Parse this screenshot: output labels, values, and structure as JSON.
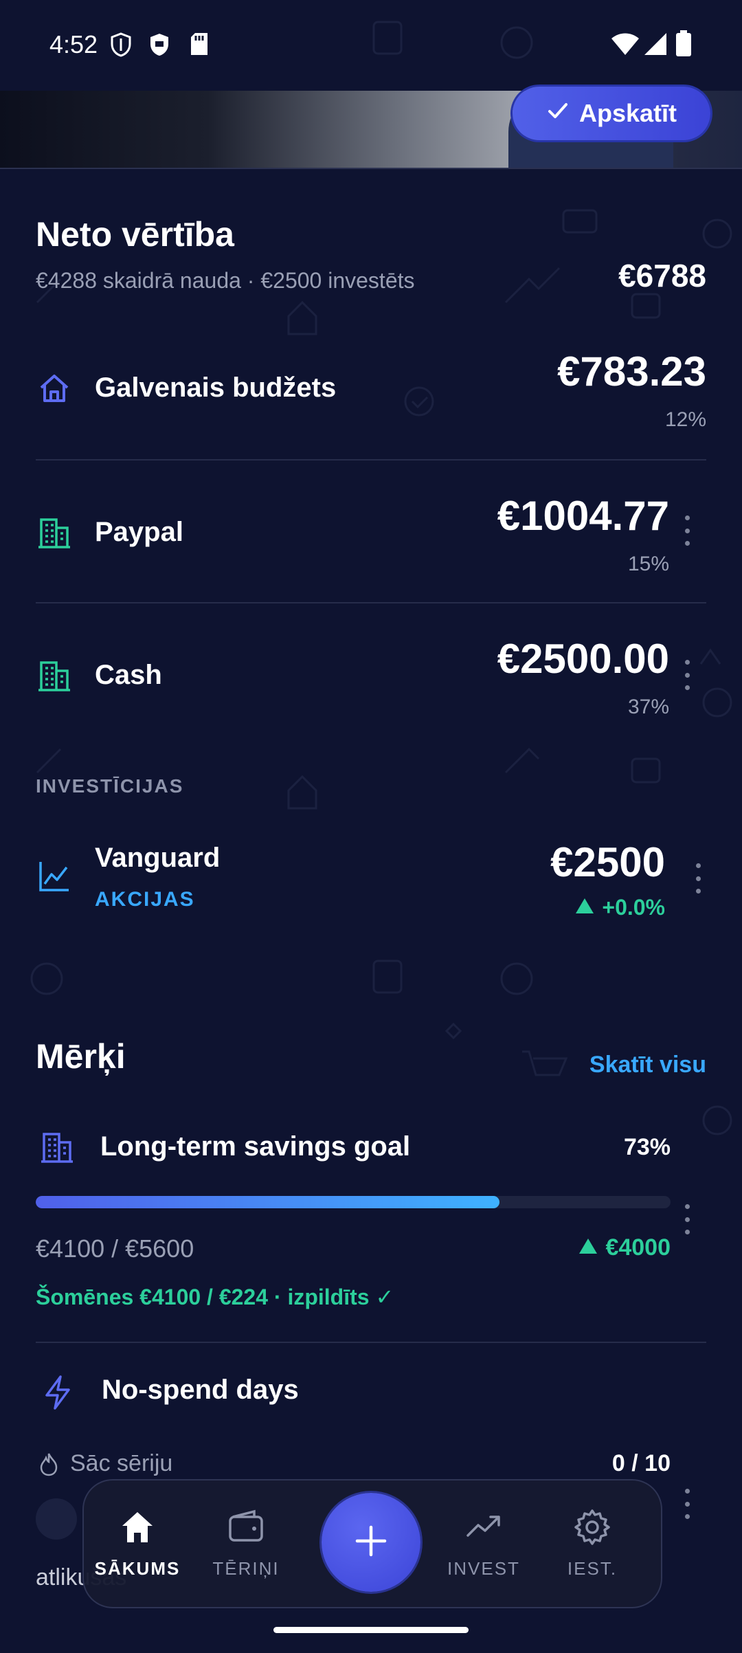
{
  "status_bar": {
    "time": "4:52"
  },
  "banner": {
    "view_button_label": "Apskatīt"
  },
  "net_worth": {
    "title": "Neto vērtība",
    "subtitle": "€4288 skaidrā nauda · €2500 investēts",
    "total": "€6788"
  },
  "accounts": [
    {
      "name": "Galvenais budžets",
      "amount": "€783.23",
      "percent": "12%",
      "icon": "home-icon"
    },
    {
      "name": "Paypal",
      "amount": "€1004.77",
      "percent": "15%",
      "icon": "building-icon"
    },
    {
      "name": "Cash",
      "amount": "€2500.00",
      "percent": "37%",
      "icon": "building-icon"
    }
  ],
  "investments": {
    "section_label": "INVESTĪCIJAS",
    "items": [
      {
        "name": "Vanguard",
        "type": "AKCIJAS",
        "amount": "€2500",
        "change": "+0.0%",
        "icon": "chart-line-icon"
      }
    ]
  },
  "goals": {
    "title": "Mērķi",
    "see_all": "Skatīt visu",
    "items": [
      {
        "name": "Long-term savings goal",
        "percent": "73%",
        "progress": 0.73,
        "progress_text": "€4100 / €5600",
        "gain": "€4000",
        "note": "Šomēnes €4100 / €224 · izpildīts ✓"
      }
    ]
  },
  "no_spend": {
    "title": "No-spend days",
    "streak_label": "Sāc sēriju",
    "streak_count": "0 / 10",
    "remaining_label": "atlikušas"
  },
  "bottom_nav": {
    "items": [
      {
        "label": "SĀKUMS",
        "icon": "home-icon",
        "active": true
      },
      {
        "label": "TĒRIŅI",
        "icon": "wallet-icon",
        "active": false
      },
      {
        "label": "INVEST",
        "icon": "trending-up-icon",
        "active": false
      },
      {
        "label": "IEST.",
        "icon": "gear-icon",
        "active": false
      }
    ],
    "fab_icon": "plus-icon"
  },
  "colors": {
    "background": "#0e1330",
    "accent": "#4a55e3",
    "link": "#39a8ff",
    "positive": "#2ccf9b",
    "muted": "#9aa0b5"
  }
}
